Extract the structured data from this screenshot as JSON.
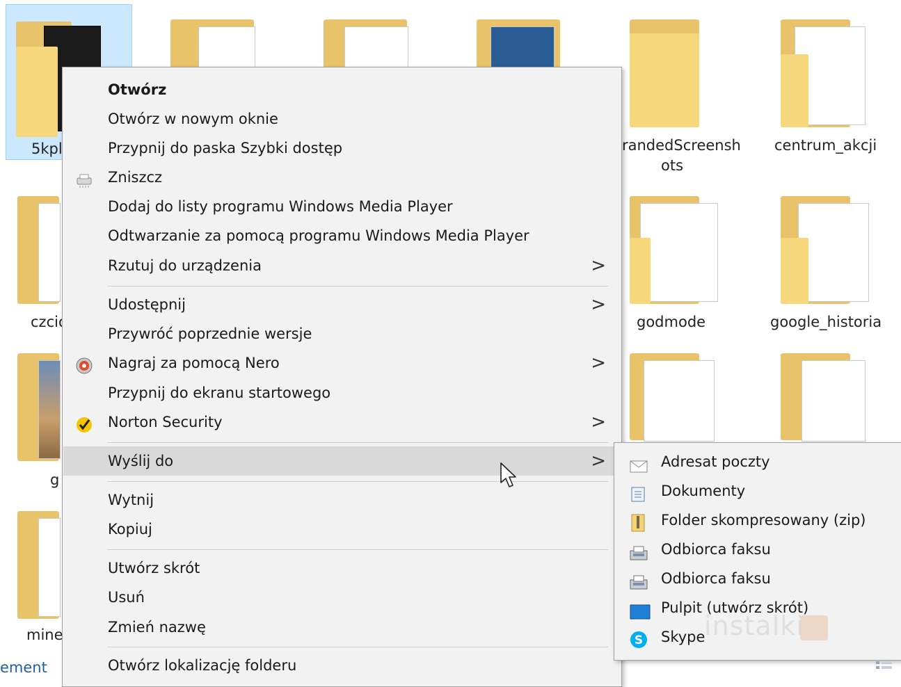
{
  "folders": {
    "top_row": [
      {
        "label": "5kpl",
        "selected": true
      },
      {
        "label": ""
      },
      {
        "label": ""
      },
      {
        "label": ""
      },
      {
        "label_line1": "randedScreensh",
        "label_line2": "ots"
      },
      {
        "label": "centrum_akcji"
      }
    ],
    "second_row": [
      {
        "label": "czcio"
      },
      {
        "label": "godmode"
      },
      {
        "label": "google_historia"
      }
    ],
    "third_row": [
      {
        "label": "g"
      }
    ],
    "fourth_row": [
      {
        "label": "mine"
      }
    ],
    "bottom_partial": "ement"
  },
  "context_menu": {
    "items": [
      {
        "label": "Otwórz",
        "bold": true
      },
      {
        "label": "Otwórz w nowym oknie"
      },
      {
        "label": "Przypnij do paska Szybki dostęp"
      },
      {
        "label": "Zniszcz",
        "icon": "shredder-icon"
      },
      {
        "label": "Dodaj do listy programu Windows Media Player"
      },
      {
        "label": "Odtwarzanie za pomocą programu Windows Media Player"
      },
      {
        "label": "Rzutuj do urządzenia",
        "submenu": true
      },
      {
        "label": "Udostępnij",
        "submenu": true
      },
      {
        "label": "Przywróć poprzednie wersje"
      },
      {
        "label": "Nagraj za pomocą Nero",
        "icon": "nero-icon",
        "submenu": true
      },
      {
        "label": "Przypnij do ekranu startowego"
      },
      {
        "label": "Norton Security",
        "icon": "norton-icon",
        "submenu": true
      },
      {
        "label": "Wyślij do",
        "submenu": true,
        "highlighted": true
      },
      {
        "label": "Wytnij"
      },
      {
        "label": "Kopiuj"
      },
      {
        "label": "Utwórz skrót"
      },
      {
        "label": "Usuń"
      },
      {
        "label": "Zmień nazwę"
      },
      {
        "label": "Otwórz lokalizację folderu"
      }
    ],
    "arrow_glyph": ">"
  },
  "send_to_submenu": {
    "items": [
      {
        "label": "Adresat poczty",
        "icon": "mail-recipient-icon"
      },
      {
        "label": "Dokumenty",
        "icon": "documents-icon"
      },
      {
        "label": "Folder skompresowany (zip)",
        "icon": "zip-folder-icon"
      },
      {
        "label": "Odbiorca faksu",
        "icon": "fax-icon"
      },
      {
        "label": "Odbiorca faksu",
        "icon": "fax-icon"
      },
      {
        "label": "Pulpit (utwórz skrót)",
        "icon": "desktop-icon"
      },
      {
        "label": "Skype",
        "icon": "skype-icon"
      }
    ]
  },
  "watermark": {
    "text": "instalki"
  },
  "colors": {
    "menu_bg": "#f2f2f2",
    "menu_highlight": "#d9d9d9",
    "selection_bg": "#cce8ff",
    "folder_yellow": "#f7d77c"
  }
}
